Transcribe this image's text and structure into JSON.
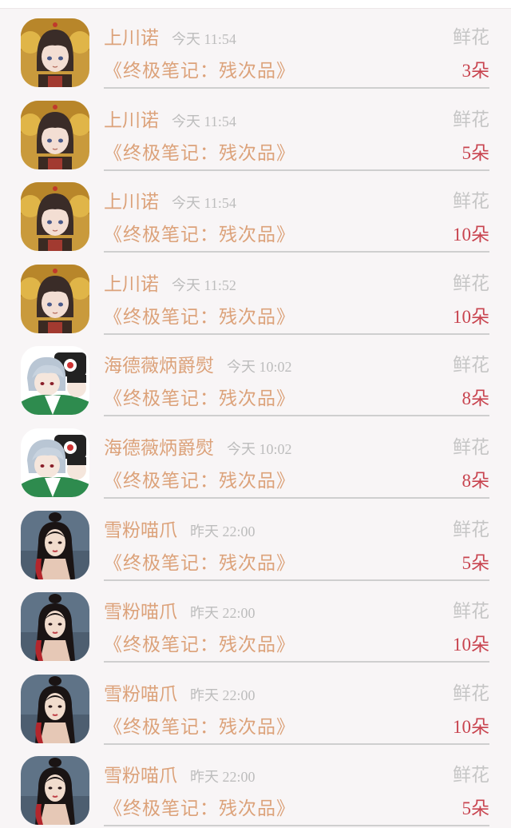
{
  "rows": [
    {
      "avatar": "avatar-a",
      "name": "上川诺",
      "day": "今天",
      "time": "11:54",
      "gift": "鲜花",
      "book": "《终极笔记：残次品》",
      "count": "3",
      "unit": "朵"
    },
    {
      "avatar": "avatar-a",
      "name": "上川诺",
      "day": "今天",
      "time": "11:54",
      "gift": "鲜花",
      "book": "《终极笔记：残次品》",
      "count": "5",
      "unit": "朵"
    },
    {
      "avatar": "avatar-a",
      "name": "上川诺",
      "day": "今天",
      "time": "11:54",
      "gift": "鲜花",
      "book": "《终极笔记：残次品》",
      "count": "10",
      "unit": "朵"
    },
    {
      "avatar": "avatar-a",
      "name": "上川诺",
      "day": "今天",
      "time": "11:52",
      "gift": "鲜花",
      "book": "《终极笔记：残次品》",
      "count": "10",
      "unit": "朵"
    },
    {
      "avatar": "avatar-b",
      "name": "海德薇炳爵熨",
      "day": "今天",
      "time": "10:02",
      "gift": "鲜花",
      "book": "《终极笔记：残次品》",
      "count": "8",
      "unit": "朵"
    },
    {
      "avatar": "avatar-b",
      "name": "海德薇炳爵熨",
      "day": "今天",
      "time": "10:02",
      "gift": "鲜花",
      "book": "《终极笔记：残次品》",
      "count": "8",
      "unit": "朵"
    },
    {
      "avatar": "avatar-c",
      "name": "雪粉喵爪",
      "day": "昨天",
      "time": "22:00",
      "gift": "鲜花",
      "book": "《终极笔记：残次品》",
      "count": "5",
      "unit": "朵"
    },
    {
      "avatar": "avatar-c",
      "name": "雪粉喵爪",
      "day": "昨天",
      "time": "22:00",
      "gift": "鲜花",
      "book": "《终极笔记：残次品》",
      "count": "10",
      "unit": "朵"
    },
    {
      "avatar": "avatar-c",
      "name": "雪粉喵爪",
      "day": "昨天",
      "time": "22:00",
      "gift": "鲜花",
      "book": "《终极笔记：残次品》",
      "count": "10",
      "unit": "朵"
    },
    {
      "avatar": "avatar-c",
      "name": "雪粉喵爪",
      "day": "昨天",
      "time": "22:00",
      "gift": "鲜花",
      "book": "《终极笔记：残次品》",
      "count": "5",
      "unit": "朵"
    }
  ],
  "colors": {
    "name": "#dca27a",
    "time": "#bdbdbd",
    "gift": "#c6c6c6",
    "count": "#c8444f",
    "divider": "#cfcfcf"
  }
}
